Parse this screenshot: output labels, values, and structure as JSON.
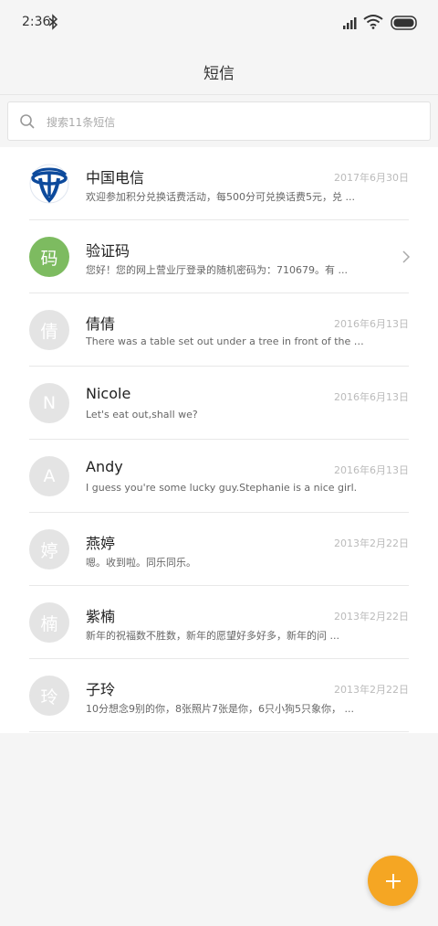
{
  "status_bar": {
    "time": "2:36"
  },
  "header": {
    "title": "短信"
  },
  "search": {
    "placeholder": "搜索11条短信"
  },
  "conversations": [
    {
      "name": "中国电信",
      "date": "2017年6月30日",
      "snippet": "欢迎参加积分兑换话费活动，每500分可兑换话费5元，兑 ...",
      "avatar_type": "telecom-logo"
    },
    {
      "name": "验证码",
      "date": "",
      "snippet": "您好！您的网上营业厅登录的随机密码为：710679。有 ...",
      "avatar_letter": "码",
      "avatar_color": "#7dbb60"
    },
    {
      "name": "倩倩",
      "date": "2016年6月13日",
      "snippet": "There was a table set out under a tree in front of the hous",
      "avatar_letter": "倩"
    },
    {
      "name": "Nicole",
      "date": "2016年6月13日",
      "snippet": "Let's eat out,shall we?",
      "avatar_letter": "N"
    },
    {
      "name": "Andy",
      "date": "2016年6月13日",
      "snippet": "I guess you're some lucky guy.Stephanie is a nice girl.",
      "avatar_letter": "A"
    },
    {
      "name": "燕婷",
      "date": "2013年2月22日",
      "snippet": "嗯。收到啦。同乐同乐。",
      "avatar_letter": "婷"
    },
    {
      "name": "紫楠",
      "date": "2013年2月22日",
      "snippet": "新年的祝福数不胜数，新年的愿望好多好多，新年的问 ...",
      "avatar_letter": "楠"
    },
    {
      "name": "子玲",
      "date": "2013年2月22日",
      "snippet": "10分想念9别的你，8张照片7张是你，6只小狗5只象你， ...",
      "avatar_letter": "玲"
    }
  ],
  "colors": {
    "accent": "#f5a623",
    "avatar_gray": "#e4e4e4",
    "telecom_blue": "#0d4a9c"
  },
  "icons": {
    "fab": "plus-icon",
    "search": "search-icon",
    "chevron": "chevron-right-icon"
  }
}
